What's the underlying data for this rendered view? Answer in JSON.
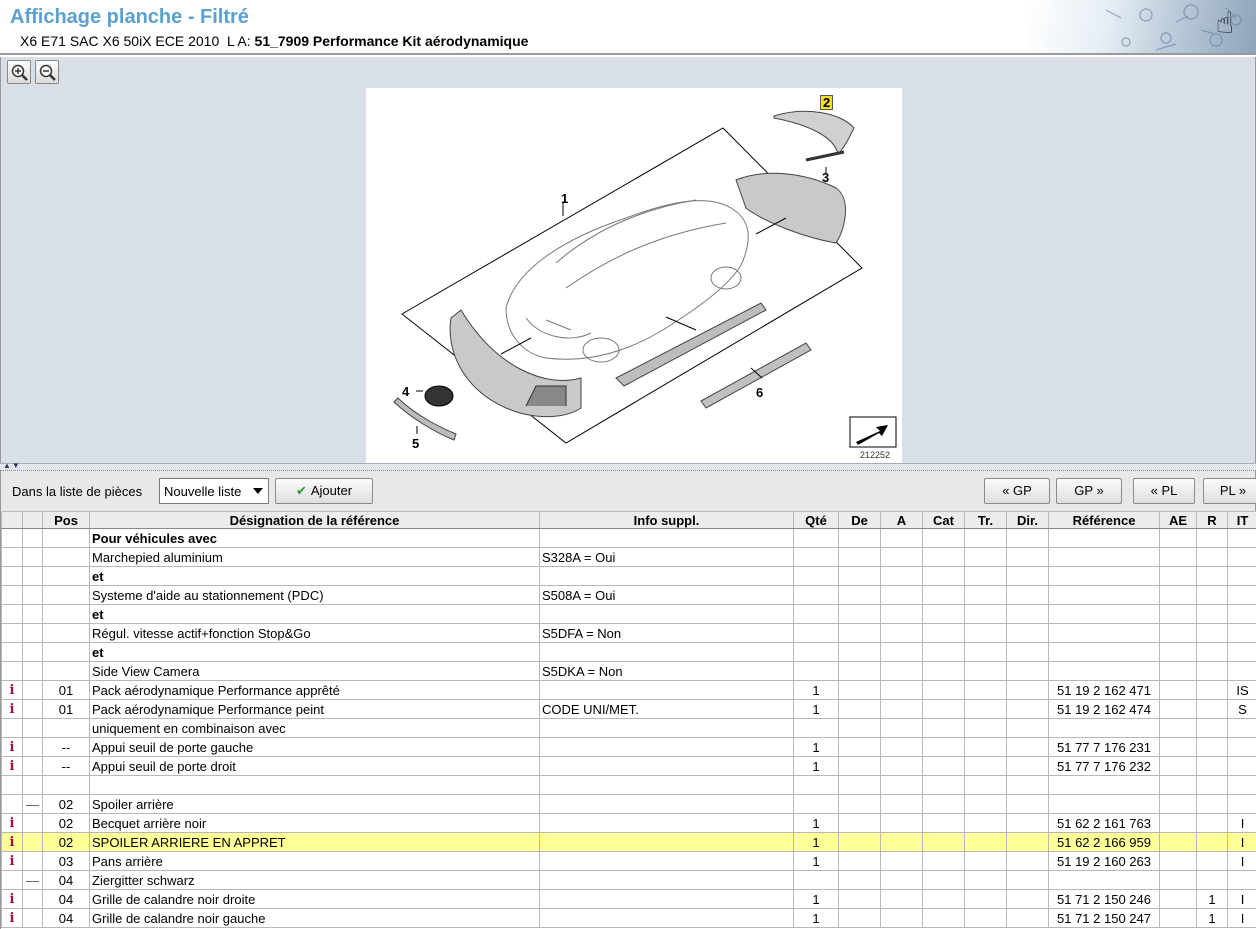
{
  "header": {
    "title": "Affichage planche - Filtré",
    "vehicle": "X6 E71 SAC X6 50iX ECE 2010",
    "la_label": "L A:",
    "group": "51_7909 Performance Kit aérodynamique"
  },
  "diagram": {
    "callouts": [
      "1",
      "2",
      "3",
      "4",
      "5",
      "6"
    ],
    "figure_number": "212252"
  },
  "toolbar": {
    "list_label": "Dans la liste de pièces",
    "list_select": "Nouvelle liste",
    "add_label": "Ajouter",
    "nav": [
      "« GP",
      "GP »",
      "« PL",
      "PL »"
    ]
  },
  "table": {
    "columns": [
      "",
      "",
      "Pos",
      "Désignation de la référence",
      "Info suppl.",
      "Qté",
      "De",
      "A",
      "Cat",
      "Tr.",
      "Dir.",
      "Référence",
      "AE",
      "R",
      "IT"
    ],
    "rows": [
      {
        "icon": "",
        "pos": "",
        "des": "Pour véhicules avec",
        "info": "",
        "qte": "",
        "ref": "",
        "r": "",
        "it": "",
        "bold": true
      },
      {
        "icon": "",
        "pos": "",
        "des": "Marchepied aluminium",
        "info": "S328A = Oui",
        "qte": "",
        "ref": "",
        "r": "",
        "it": ""
      },
      {
        "icon": "",
        "pos": "",
        "des": "et",
        "info": "",
        "qte": "",
        "ref": "",
        "r": "",
        "it": "",
        "bold": true
      },
      {
        "icon": "",
        "pos": "",
        "des": "Systeme d'aide au stationnement (PDC)",
        "info": "S508A = Oui",
        "qte": "",
        "ref": "",
        "r": "",
        "it": ""
      },
      {
        "icon": "",
        "pos": "",
        "des": "et",
        "info": "",
        "qte": "",
        "ref": "",
        "r": "",
        "it": "",
        "bold": true
      },
      {
        "icon": "",
        "pos": "",
        "des": "Régul. vitesse actif+fonction Stop&Go",
        "info": "S5DFA = Non",
        "qte": "",
        "ref": "",
        "r": "",
        "it": ""
      },
      {
        "icon": "",
        "pos": "",
        "des": "et",
        "info": "",
        "qte": "",
        "ref": "",
        "r": "",
        "it": "",
        "bold": true
      },
      {
        "icon": "",
        "pos": "",
        "des": "Side View Camera",
        "info": "S5DKA = Non",
        "qte": "",
        "ref": "",
        "r": "",
        "it": ""
      },
      {
        "icon": "i",
        "pos": "01",
        "des": "Pack aérodynamique Performance apprêté",
        "info": "",
        "qte": "1",
        "ref": "51 19 2 162 471",
        "r": "",
        "it": "IS"
      },
      {
        "icon": "i",
        "pos": "01",
        "des": "Pack aérodynamique Performance peint",
        "info": "CODE UNI/MET.",
        "qte": "1",
        "ref": "51 19 2 162 474",
        "r": "",
        "it": "S"
      },
      {
        "icon": "",
        "pos": "",
        "des": "uniquement en combinaison avec",
        "info": "",
        "qte": "",
        "ref": "",
        "r": "",
        "it": ""
      },
      {
        "icon": "i",
        "pos": "--",
        "des": "Appui seuil de porte gauche",
        "info": "",
        "qte": "1",
        "ref": "51 77 7 176 231",
        "r": "",
        "it": ""
      },
      {
        "icon": "i",
        "pos": "--",
        "des": "Appui seuil de porte droit",
        "info": "",
        "qte": "1",
        "ref": "51 77 7 176 232",
        "r": "",
        "it": ""
      },
      {
        "icon": "",
        "pos": "",
        "des": "",
        "info": "",
        "qte": "",
        "ref": "",
        "r": "",
        "it": ""
      },
      {
        "icon": "—",
        "pos": "02",
        "des": "Spoiler arrière",
        "info": "",
        "qte": "",
        "ref": "",
        "r": "",
        "it": ""
      },
      {
        "icon": "i",
        "pos": "02",
        "des": "Becquet arrière noir",
        "info": "",
        "qte": "1",
        "ref": "51 62 2 161 763",
        "r": "",
        "it": "I"
      },
      {
        "icon": "i",
        "pos": "02",
        "des": "SPOILER ARRIERE EN APPRET",
        "info": "",
        "qte": "1",
        "ref": "51 62 2 166 959",
        "r": "",
        "it": "I",
        "selected": true
      },
      {
        "icon": "i",
        "pos": "03",
        "des": "Pans arrière",
        "info": "",
        "qte": "1",
        "ref": "51 19 2 160 263",
        "r": "",
        "it": "I"
      },
      {
        "icon": "—",
        "pos": "04",
        "des": "Ziergitter schwarz",
        "info": "",
        "qte": "",
        "ref": "",
        "r": "",
        "it": ""
      },
      {
        "icon": "i",
        "pos": "04",
        "des": "Grille de calandre noir droite",
        "info": "",
        "qte": "1",
        "ref": "51 71 2 150 246",
        "r": "1",
        "it": "I"
      },
      {
        "icon": "i",
        "pos": "04",
        "des": "Grille de calandre noir gauche",
        "info": "",
        "qte": "1",
        "ref": "51 71 2 150 247",
        "r": "1",
        "it": "I"
      }
    ]
  },
  "colors": {
    "title": "#5aa0d0",
    "selected_row": "#ffff99",
    "info_icon": "#a0103a",
    "callout_highlight": "#f4e11b"
  }
}
